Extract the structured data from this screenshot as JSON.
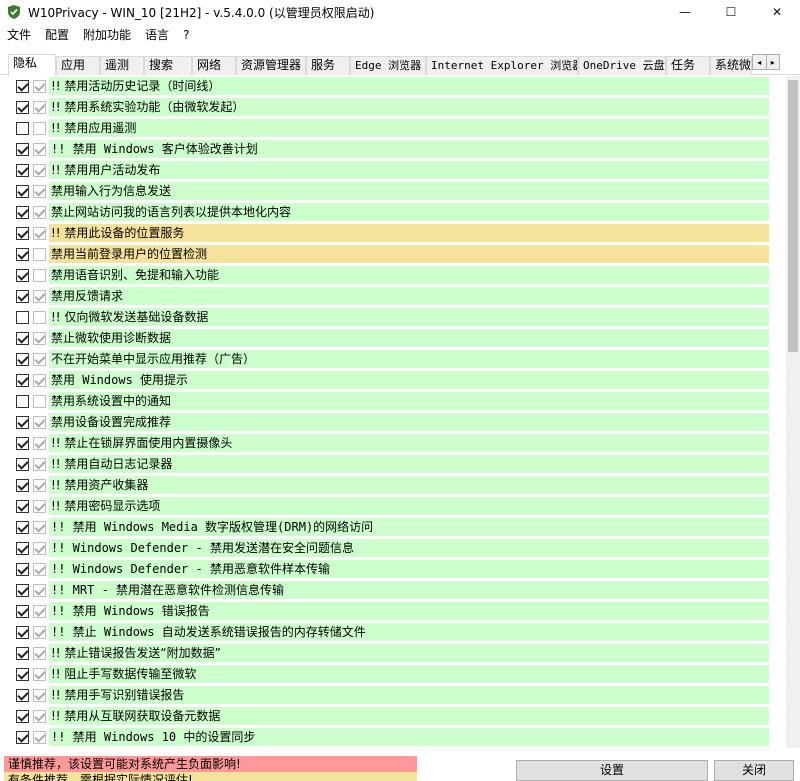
{
  "window": {
    "title": "W10Privacy - WIN_10 [21H2]  - v.5.4.0.0 (以管理员权限启动)",
    "minimize": "—",
    "maximize": "☐",
    "close": "✕"
  },
  "menu": [
    "文件",
    "配置",
    "附加功能",
    "语言",
    "?"
  ],
  "tabs": [
    "隐私",
    "应用",
    "遥测",
    "搜索",
    "网络",
    "资源管理器",
    "服务",
    "Edge 浏览器",
    "Internet Explorer 浏览器",
    "OneDrive 云盘",
    "任务",
    "系统微"
  ],
  "tab_scroll": {
    "left": "◂",
    "right": "▸"
  },
  "colors": {
    "green": "#ccffcc",
    "yellow": "#f5e39b",
    "red": "#ff9999"
  },
  "items": [
    {
      "text": "!! 禁用活动历史记录（时间线）",
      "c1": true,
      "c2": true,
      "bg": "g"
    },
    {
      "text": "!! 禁用系统实验功能（由微软发起）",
      "c1": true,
      "c2": true,
      "bg": "g"
    },
    {
      "text": "!! 禁用应用遥测",
      "c1": false,
      "c2": false,
      "bg": "g"
    },
    {
      "text": "!! 禁用 Windows 客户体验改善计划",
      "c1": true,
      "c2": true,
      "bg": "g"
    },
    {
      "text": "!! 禁用用户活动发布",
      "c1": true,
      "c2": true,
      "bg": "g"
    },
    {
      "text": "禁用输入行为信息发送",
      "c1": true,
      "c2": true,
      "bg": "g"
    },
    {
      "text": "禁止网站访问我的语言列表以提供本地化内容",
      "c1": true,
      "c2": true,
      "bg": "g"
    },
    {
      "text": "!! 禁用此设备的位置服务",
      "c1": true,
      "c2": true,
      "bg": "y"
    },
    {
      "text": "禁用当前登录用户的位置检测",
      "c1": true,
      "c2": false,
      "bg": "y"
    },
    {
      "text": "禁用语音识别、免提和输入功能",
      "c1": true,
      "c2": false,
      "bg": "g"
    },
    {
      "text": "禁用反馈请求",
      "c1": true,
      "c2": true,
      "bg": "g"
    },
    {
      "text": "!! 仅向微软发送基础设备数据",
      "c1": false,
      "c2": false,
      "bg": "g"
    },
    {
      "text": "禁止微软使用诊断数据",
      "c1": true,
      "c2": true,
      "bg": "g"
    },
    {
      "text": "不在开始菜单中显示应用推荐（广告）",
      "c1": true,
      "c2": true,
      "bg": "g"
    },
    {
      "text": "禁用 Windows 使用提示",
      "c1": true,
      "c2": true,
      "bg": "g"
    },
    {
      "text": "禁用系统设置中的通知",
      "c1": false,
      "c2": false,
      "bg": "g"
    },
    {
      "text": "禁用设备设置完成推荐",
      "c1": true,
      "c2": true,
      "bg": "g"
    },
    {
      "text": "!! 禁止在锁屏界面使用内置摄像头",
      "c1": true,
      "c2": true,
      "bg": "g"
    },
    {
      "text": "!! 禁用自动日志记录器",
      "c1": true,
      "c2": true,
      "bg": "g"
    },
    {
      "text": "!! 禁用资产收集器",
      "c1": true,
      "c2": true,
      "bg": "g"
    },
    {
      "text": "!! 禁用密码显示选项",
      "c1": true,
      "c2": true,
      "bg": "g"
    },
    {
      "text": "!! 禁用 Windows Media 数字版权管理(DRM)的网络访问",
      "c1": true,
      "c2": true,
      "bg": "g"
    },
    {
      "text": "!! Windows Defender - 禁用发送潜在安全问题信息",
      "c1": true,
      "c2": true,
      "bg": "g"
    },
    {
      "text": "!! Windows Defender - 禁用恶意软件样本传输",
      "c1": true,
      "c2": true,
      "bg": "g"
    },
    {
      "text": "!! MRT - 禁用潜在恶意软件检测信息传输",
      "c1": true,
      "c2": true,
      "bg": "g"
    },
    {
      "text": "!! 禁用 Windows 错误报告",
      "c1": true,
      "c2": true,
      "bg": "g"
    },
    {
      "text": "!! 禁止 Windows 自动发送系统错误报告的内存转储文件",
      "c1": true,
      "c2": true,
      "bg": "g"
    },
    {
      "text": "!! 禁止错误报告发送“附加数据”",
      "c1": true,
      "c2": true,
      "bg": "g"
    },
    {
      "text": "!! 阻止手写数据传输至微软",
      "c1": true,
      "c2": true,
      "bg": "g"
    },
    {
      "text": "!! 禁用手写识别错误报告",
      "c1": true,
      "c2": true,
      "bg": "g"
    },
    {
      "text": "!! 禁用从互联网获取设备元数据",
      "c1": true,
      "c2": true,
      "bg": "g"
    },
    {
      "text": "!! 禁用 Windows 10 中的设置同步",
      "c1": true,
      "c2": true,
      "bg": "g"
    }
  ],
  "legend": {
    "red": "谨慎推荐，该设置可能对系统产生负面影响!",
    "yellow": "有条件推荐，需根据实际情况评估!"
  },
  "buttons": {
    "settings": "设置",
    "close": "关闭"
  }
}
